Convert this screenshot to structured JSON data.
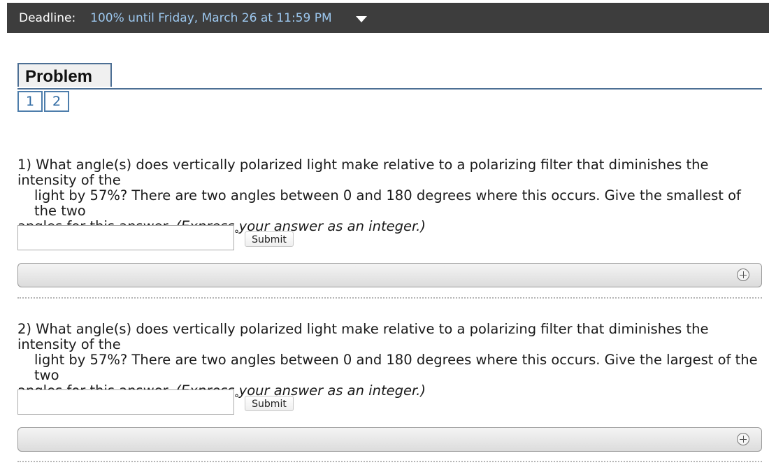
{
  "deadline": {
    "label": "Deadline:",
    "value": "100% until Friday, March 26 at 11:59 PM"
  },
  "problem": {
    "title": "Problem 1",
    "parts": [
      "1",
      "2"
    ]
  },
  "questions": [
    {
      "line1": "1) What angle(s) does vertically polarized light make relative to a polarizing filter that diminishes the intensity of the",
      "line2": "light by 57%? There are two angles between 0 and 180 degrees where this occurs. Give the smallest of the two",
      "line3": "angles for this answer.",
      "instruction": "(Express your answer as an integer.)",
      "answer_value": "",
      "unit": "°",
      "submit_label": "Submit"
    },
    {
      "line1": "2) What angle(s) does vertically polarized light make relative to a polarizing filter that diminishes the intensity of the",
      "line2": "light by 57%? There are two angles between 0 and 180 degrees where this occurs. Give the largest of the two",
      "line3": "angles for this answer.",
      "instruction": "(Express your answer as an integer.)",
      "answer_value": "",
      "unit": "°",
      "submit_label": "Submit"
    }
  ],
  "colors": {
    "deadline_bar": "#3d3d3d",
    "deadline_value": "#9cc7ee",
    "accent_border": "#4d6f94"
  }
}
